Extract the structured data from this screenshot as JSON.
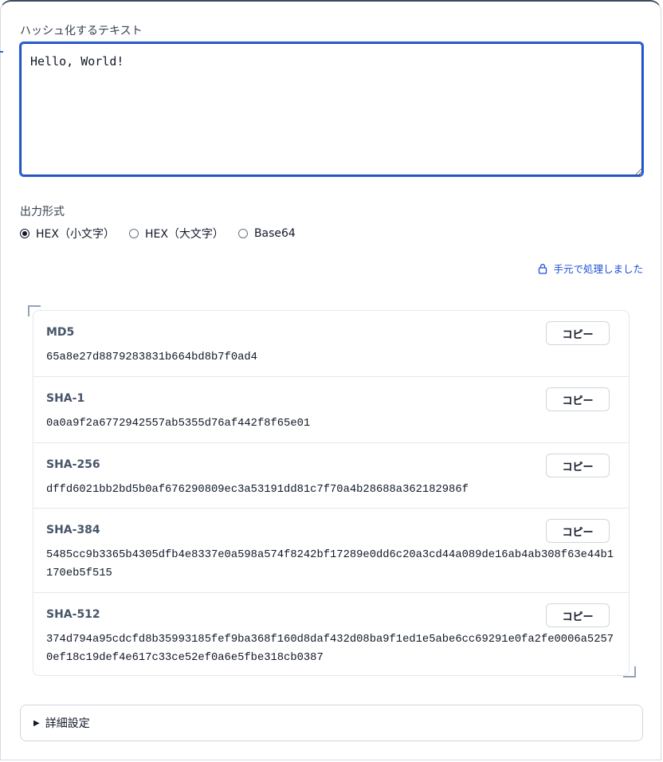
{
  "input": {
    "label": "ハッシュ化するテキスト",
    "value": "Hello, World!"
  },
  "format": {
    "label": "出力形式",
    "options": [
      {
        "label": "HEX（小文字）",
        "selected": true
      },
      {
        "label": "HEX（大文字）",
        "selected": false
      },
      {
        "label": "Base64",
        "selected": false
      }
    ]
  },
  "status": {
    "text": "手元で処理しました",
    "icon": "lock-icon",
    "color": "#1d4ed8"
  },
  "results": [
    {
      "algorithm": "MD5",
      "hash": "65a8e27d8879283831b664bd8b7f0ad4",
      "copy_label": "コピー"
    },
    {
      "algorithm": "SHA-1",
      "hash": "0a0a9f2a6772942557ab5355d76af442f8f65e01",
      "copy_label": "コピー"
    },
    {
      "algorithm": "SHA-256",
      "hash": "dffd6021bb2bd5b0af676290809ec3a53191dd81c7f70a4b28688a362182986f",
      "copy_label": "コピー"
    },
    {
      "algorithm": "SHA-384",
      "hash": "5485cc9b3365b4305dfb4e8337e0a598a574f8242bf17289e0dd6c20a3cd44a089de16ab4ab308f63e44b1170eb5f515",
      "copy_label": "コピー"
    },
    {
      "algorithm": "SHA-512",
      "hash": "374d794a95cdcfd8b35993185fef9ba368f160d8daf432d08ba9f1ed1e5abe6cc69291e0fa2fe0006a52570ef18c19def4e617c33ce52ef0a6e5fbe318cb0387",
      "copy_label": "コピー"
    }
  ],
  "advanced": {
    "label": "詳細設定",
    "expanded": false
  },
  "accent_color": "#2563eb"
}
